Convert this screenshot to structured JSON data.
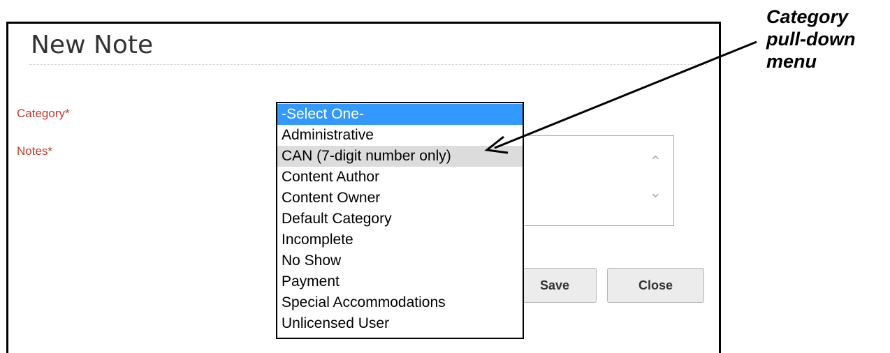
{
  "dialog": {
    "title": "New Note",
    "category_label": "Category*",
    "notes_label": "Notes*",
    "save_label": "Save",
    "close_label": "Close"
  },
  "category_dropdown": {
    "options": [
      "-Select One-",
      "Administrative",
      "CAN (7-digit number only)",
      "Content Author",
      "Content Owner",
      "Default Category",
      "Incomplete",
      "No Show",
      "Payment",
      "Special Accommodations",
      "Unlicensed User"
    ],
    "selected_option": "-Select One-",
    "hovered_option": "CAN (7-digit number only)"
  },
  "annotation": {
    "lines": [
      "Category",
      "pull-down",
      "menu"
    ]
  },
  "colors": {
    "required_label": "#c0392b",
    "selected_option_bg": "#3399ff",
    "hovered_option_bg": "#dcdcdc"
  },
  "icons": {
    "scroll_up": "chevron-up-icon",
    "scroll_down": "chevron-down-icon",
    "annotation_arrow": "arrow-icon"
  }
}
